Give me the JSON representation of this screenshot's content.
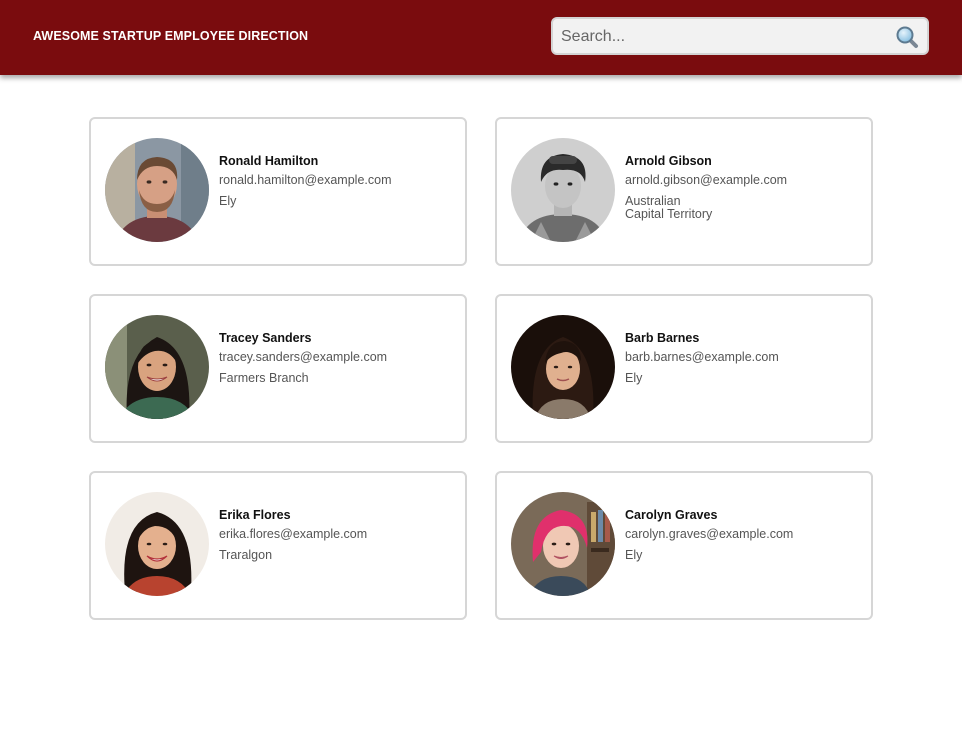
{
  "header": {
    "title": "AWESOME STARTUP EMPLOYEE DIRECTION",
    "background": "#7a0c0e"
  },
  "search": {
    "placeholder": "Search...",
    "value": "",
    "icon": "magnifier-icon"
  },
  "employees": [
    {
      "name": "Ronald Hamilton",
      "email": "ronald.hamilton@example.com",
      "city": "Ely"
    },
    {
      "name": "Arnold Gibson",
      "email": "arnold.gibson@example.com",
      "city": "Australian\nCapital Territory"
    },
    {
      "name": "Tracey Sanders",
      "email": "tracey.sanders@example.com",
      "city": "Farmers Branch"
    },
    {
      "name": "Barb Barnes",
      "email": "barb.barnes@example.com",
      "city": "Ely"
    },
    {
      "name": "Erika Flores",
      "email": "erika.flores@example.com",
      "city": "Traralgon"
    },
    {
      "name": "Carolyn Graves",
      "email": "carolyn.graves@example.com",
      "city": "Ely"
    }
  ]
}
